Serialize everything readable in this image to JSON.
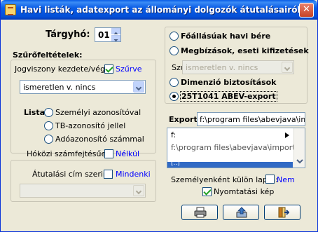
{
  "window": {
    "title": "Havi listák, adatexport az állományi dolgozók átutalásairól",
    "close_glyph": "✕"
  },
  "targyho": {
    "label": "Tárgyhó:",
    "value": "01"
  },
  "filters": {
    "heading": "Szűrőfeltételek:",
    "jogviszony_label": "Jogviszony kezdete/vége:",
    "szurve_label": "Szűrve",
    "szurve_checked": true,
    "combo_value": "ismeretlen v. nincs"
  },
  "lista": {
    "label": "Lista:",
    "options": [
      "Személyi azonosítóval",
      "TB-azonosító jellel",
      "Adóazonosító számmal"
    ],
    "selected": null
  },
  "hokozi": {
    "label": "Hóközi számfejtésűek:",
    "check_label": "Nélkül",
    "checked": false
  },
  "atutalasi": {
    "label": "Átutalási cím szerint:",
    "check_label": "Mindenki",
    "checked": false,
    "combo_value": ""
  },
  "report_types": {
    "options": [
      "Főállásúak havi bére",
      "Megbízások, eseti kifizetések",
      "Dimenzió biztosítások",
      "25T1041 ABEV-export"
    ],
    "selected_index": 3
  },
  "szuro": {
    "label": "Szűrő:",
    "value": "ismeretlen v. nincs"
  },
  "export": {
    "label": "Export:",
    "path": "f:\\program files\\abevjava\\impor",
    "list_drive": "f:",
    "list_folder": "f:\\program files\\abevjava\\import\\",
    "list_selected": "[..]"
  },
  "szemelyenkent": {
    "label": "Személyenként külön lapra:",
    "check_label": "Nem",
    "checked": false
  },
  "nyomtatasi": {
    "label": "Nyomtatási kép",
    "checked": true
  },
  "buttons": [
    {
      "name": "print-button",
      "icon": "printer-icon"
    },
    {
      "name": "export-button",
      "icon": "export-icon"
    },
    {
      "name": "exit-button",
      "icon": "exit-door-icon"
    }
  ],
  "colors": {
    "titlebar": "#0a5de6",
    "face": "#ece9d8",
    "accent_blue": "#0000ff",
    "selection": "#316ac5"
  }
}
